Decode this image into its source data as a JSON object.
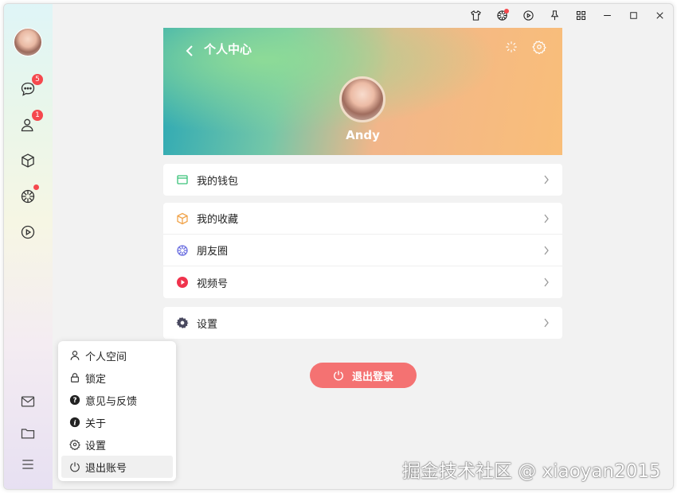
{
  "sidebar": {
    "chat_badge": "5",
    "contacts_badge": "1"
  },
  "toolbar": {
    "items": [
      "shirt-icon",
      "moments-icon",
      "play-icon",
      "pin-icon",
      "grid-icon",
      "minimize-icon",
      "maximize-icon",
      "close-icon"
    ]
  },
  "banner": {
    "title": "个人中心",
    "username": "Andy"
  },
  "cards": {
    "wallet": "我的钱包",
    "favorites": "我的收藏",
    "moments": "朋友圈",
    "channels": "视频号",
    "settings": "设置"
  },
  "logout_button": "退出登录",
  "popup_menu": {
    "items": [
      "个人空间",
      "锁定",
      "意见与反馈",
      "关于",
      "设置",
      "退出账号"
    ]
  },
  "watermark": "掘金技术社区 @ xiaoyan2015",
  "colors": {
    "accent_red": "#f47272",
    "badge_red": "#f5484d",
    "wallet_green": "#3ac27a",
    "favorites_orange": "#f0a34a",
    "moments_purple": "#6b6fe0",
    "channels_red": "#f0334d"
  }
}
